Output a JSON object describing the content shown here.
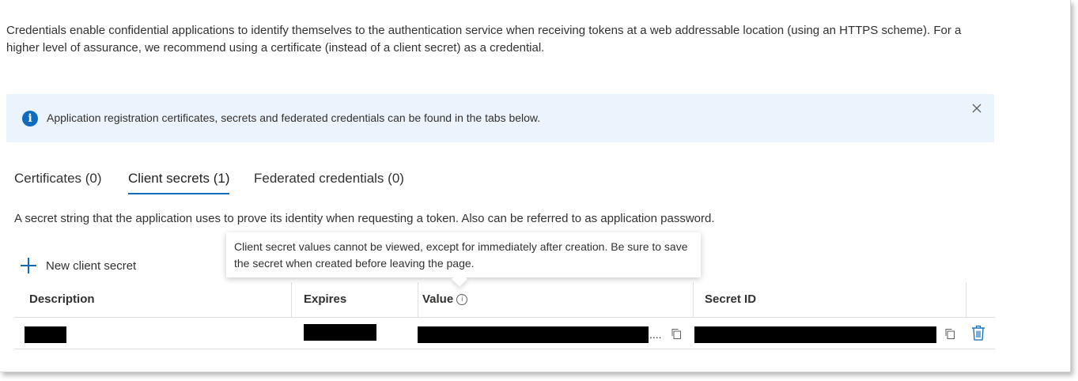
{
  "intro": {
    "text": "Credentials enable confidential applications to identify themselves to the authentication service when receiving tokens at a web addressable location (using an HTTPS scheme). For a higher level of assurance, we recommend using a certificate (instead of a client secret) as a credential."
  },
  "info_bar": {
    "icon": "info-icon",
    "text": "Application registration certificates, secrets and federated credentials can be found in the tabs below.",
    "close_icon": "close-icon"
  },
  "tabs": [
    {
      "label": "Certificates (0)",
      "selected": false
    },
    {
      "label": "Client secrets (1)",
      "selected": true
    },
    {
      "label": "Federated credentials (0)",
      "selected": false
    }
  ],
  "description": "A secret string that the application uses to prove its identity when requesting a token. Also can be referred to as application password.",
  "new_secret_button": {
    "label": "New client secret",
    "icon": "plus-icon"
  },
  "tooltip": {
    "text": "Client secret values cannot be viewed, except for immediately after creation. Be sure to save the secret when created before leaving the page."
  },
  "table": {
    "columns": [
      "Description",
      "Expires",
      "Value",
      "Secret ID"
    ],
    "rows": [
      {
        "description": "",
        "expires": "",
        "value": "",
        "value_suffix": "....",
        "secret_id": ""
      }
    ]
  },
  "colors": {
    "accent": "#0f6cbd",
    "info_background": "#ebf3fc",
    "redaction": "#000000"
  }
}
